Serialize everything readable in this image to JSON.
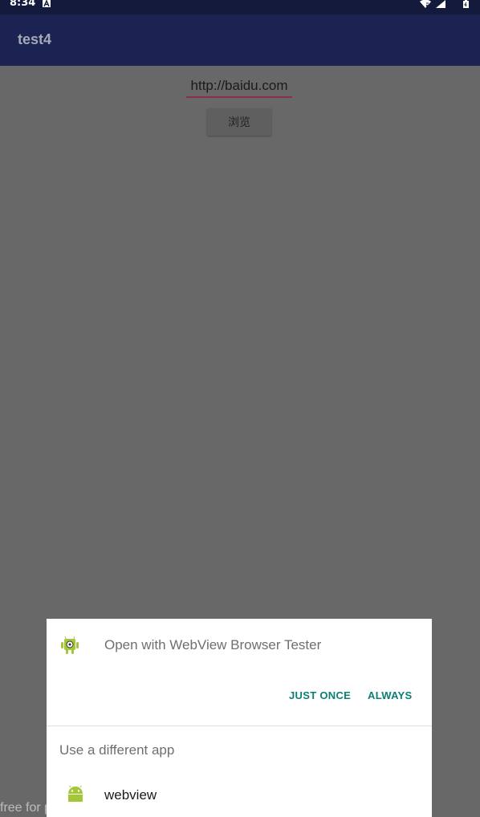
{
  "status_bar": {
    "time": "8:34",
    "icons": [
      "notification-a-icon",
      "wifi-icon",
      "signal-icon",
      "battery-icon"
    ]
  },
  "app_bar": {
    "title": "test4"
  },
  "main": {
    "url_value": "http://baidu.com",
    "browse_label": "浏览"
  },
  "dialog": {
    "title": "Open with WebView Browser Tester",
    "just_once": "JUST ONCE",
    "always": "ALWAYS",
    "different_app": "Use a different app",
    "apps": [
      {
        "label": "webview",
        "icon": "android-icon"
      }
    ]
  },
  "watermark": {
    "text": "free for personal use"
  },
  "colors": {
    "accent": "#0a7f74",
    "app_bar": "#1a2352",
    "status_bar": "#141a3c",
    "underline": "#8d2c4c",
    "android_green": "#a4c639"
  }
}
